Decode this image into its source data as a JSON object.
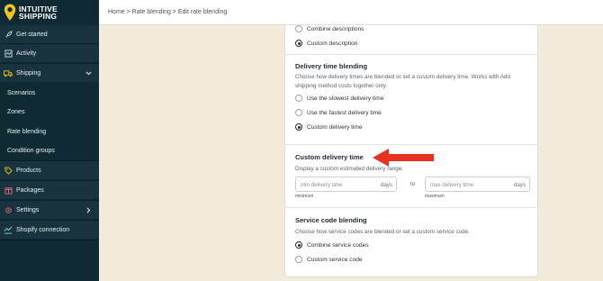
{
  "app": {
    "brand_line1": "INTUITIVE",
    "brand_line2": "SHIPPING",
    "accent": "#f5c518"
  },
  "sidebar": {
    "items": [
      {
        "label": "Get started",
        "icon": "rocket-icon"
      },
      {
        "label": "Activity",
        "icon": "activity-icon"
      },
      {
        "label": "Shipping",
        "icon": "truck-icon",
        "expanded": true
      },
      {
        "label": "Scenarios"
      },
      {
        "label": "Zones"
      },
      {
        "label": "Rate blending"
      },
      {
        "label": "Condition groups"
      },
      {
        "label": "Products",
        "icon": "tag-icon"
      },
      {
        "label": "Packages",
        "icon": "package-icon"
      },
      {
        "label": "Settings",
        "icon": "gear-icon"
      },
      {
        "label": "Shopify connection",
        "icon": "connection-icon"
      }
    ]
  },
  "breadcrumb": "Home > Rate blending > Edit rate blending",
  "description_section": {
    "options": [
      {
        "label": "Combine descriptions",
        "selected": false
      },
      {
        "label": "Custom description",
        "selected": true
      }
    ]
  },
  "delivery_time_blending": {
    "title": "Delivery time blending",
    "description": "Choose how delivery times are blended or set a custom delivery time. Works with Add shipping method costs together only.",
    "options": [
      {
        "label": "Use the slowest delivery time",
        "selected": false
      },
      {
        "label": "Use the fastest delivery time",
        "selected": false
      },
      {
        "label": "Custom delivery time",
        "selected": true
      }
    ]
  },
  "custom_delivery_time": {
    "title": "Custom delivery time",
    "description": "Display a custom estimated delivery range.",
    "min_placeholder": "min delivery time",
    "max_placeholder": "max delivery time",
    "suffix": "days",
    "separator": "to",
    "min_hint": "minimum",
    "max_hint": "maximum"
  },
  "service_code_blending": {
    "title": "Service code blending",
    "description": "Choose how service codes are blended or set a custom service code.",
    "options": [
      {
        "label": "Combine service codes",
        "selected": true
      },
      {
        "label": "Custom service code",
        "selected": false
      }
    ]
  },
  "annotation": {
    "arrow_color": "#e8321f"
  }
}
